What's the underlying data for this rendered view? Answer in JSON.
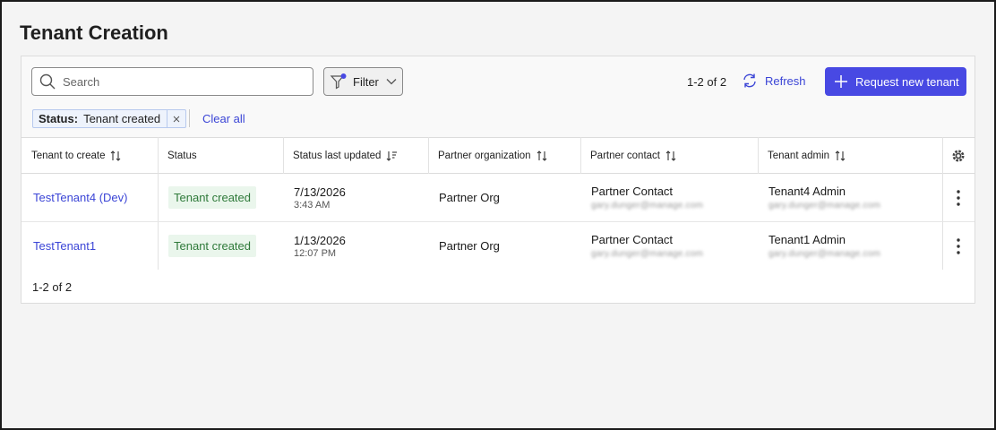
{
  "page": {
    "title": "Tenant Creation"
  },
  "toolbar": {
    "search_placeholder": "Search",
    "filter_label": "Filter",
    "count": "1-2 of 2",
    "refresh_label": "Refresh",
    "primary_label": "Request new tenant"
  },
  "filters": {
    "chip_key": "Status:",
    "chip_value": "Tenant created",
    "clear_all": "Clear all"
  },
  "table": {
    "columns": [
      "Tenant to create",
      "Status",
      "Status last updated",
      "Partner organization",
      "Partner contact",
      "Tenant admin"
    ],
    "rows": [
      {
        "tenant": "TestTenant4 (Dev)",
        "status": "Tenant created",
        "date": "7/13/2026",
        "time": "3:43 AM",
        "org": "Partner Org",
        "contact_name": "Partner Contact",
        "contact_email": "gary.dunger@manage.com",
        "admin_name": "Tenant4 Admin",
        "admin_email": "gary.dunger@manage.com"
      },
      {
        "tenant": "TestTenant1",
        "status": "Tenant created",
        "date": "1/13/2026",
        "time": "12:07 PM",
        "org": "Partner Org",
        "contact_name": "Partner Contact",
        "contact_email": "gary.dunger@manage.com",
        "admin_name": "Tenant1 Admin",
        "admin_email": "gary.dunger@manage.com"
      }
    ]
  },
  "footer": {
    "count": "1-2 of 2"
  },
  "colors": {
    "accent": "#4849e3",
    "link": "#3b45d6",
    "status_bg": "#eaf6ec",
    "status_text": "#2f7a3a"
  }
}
